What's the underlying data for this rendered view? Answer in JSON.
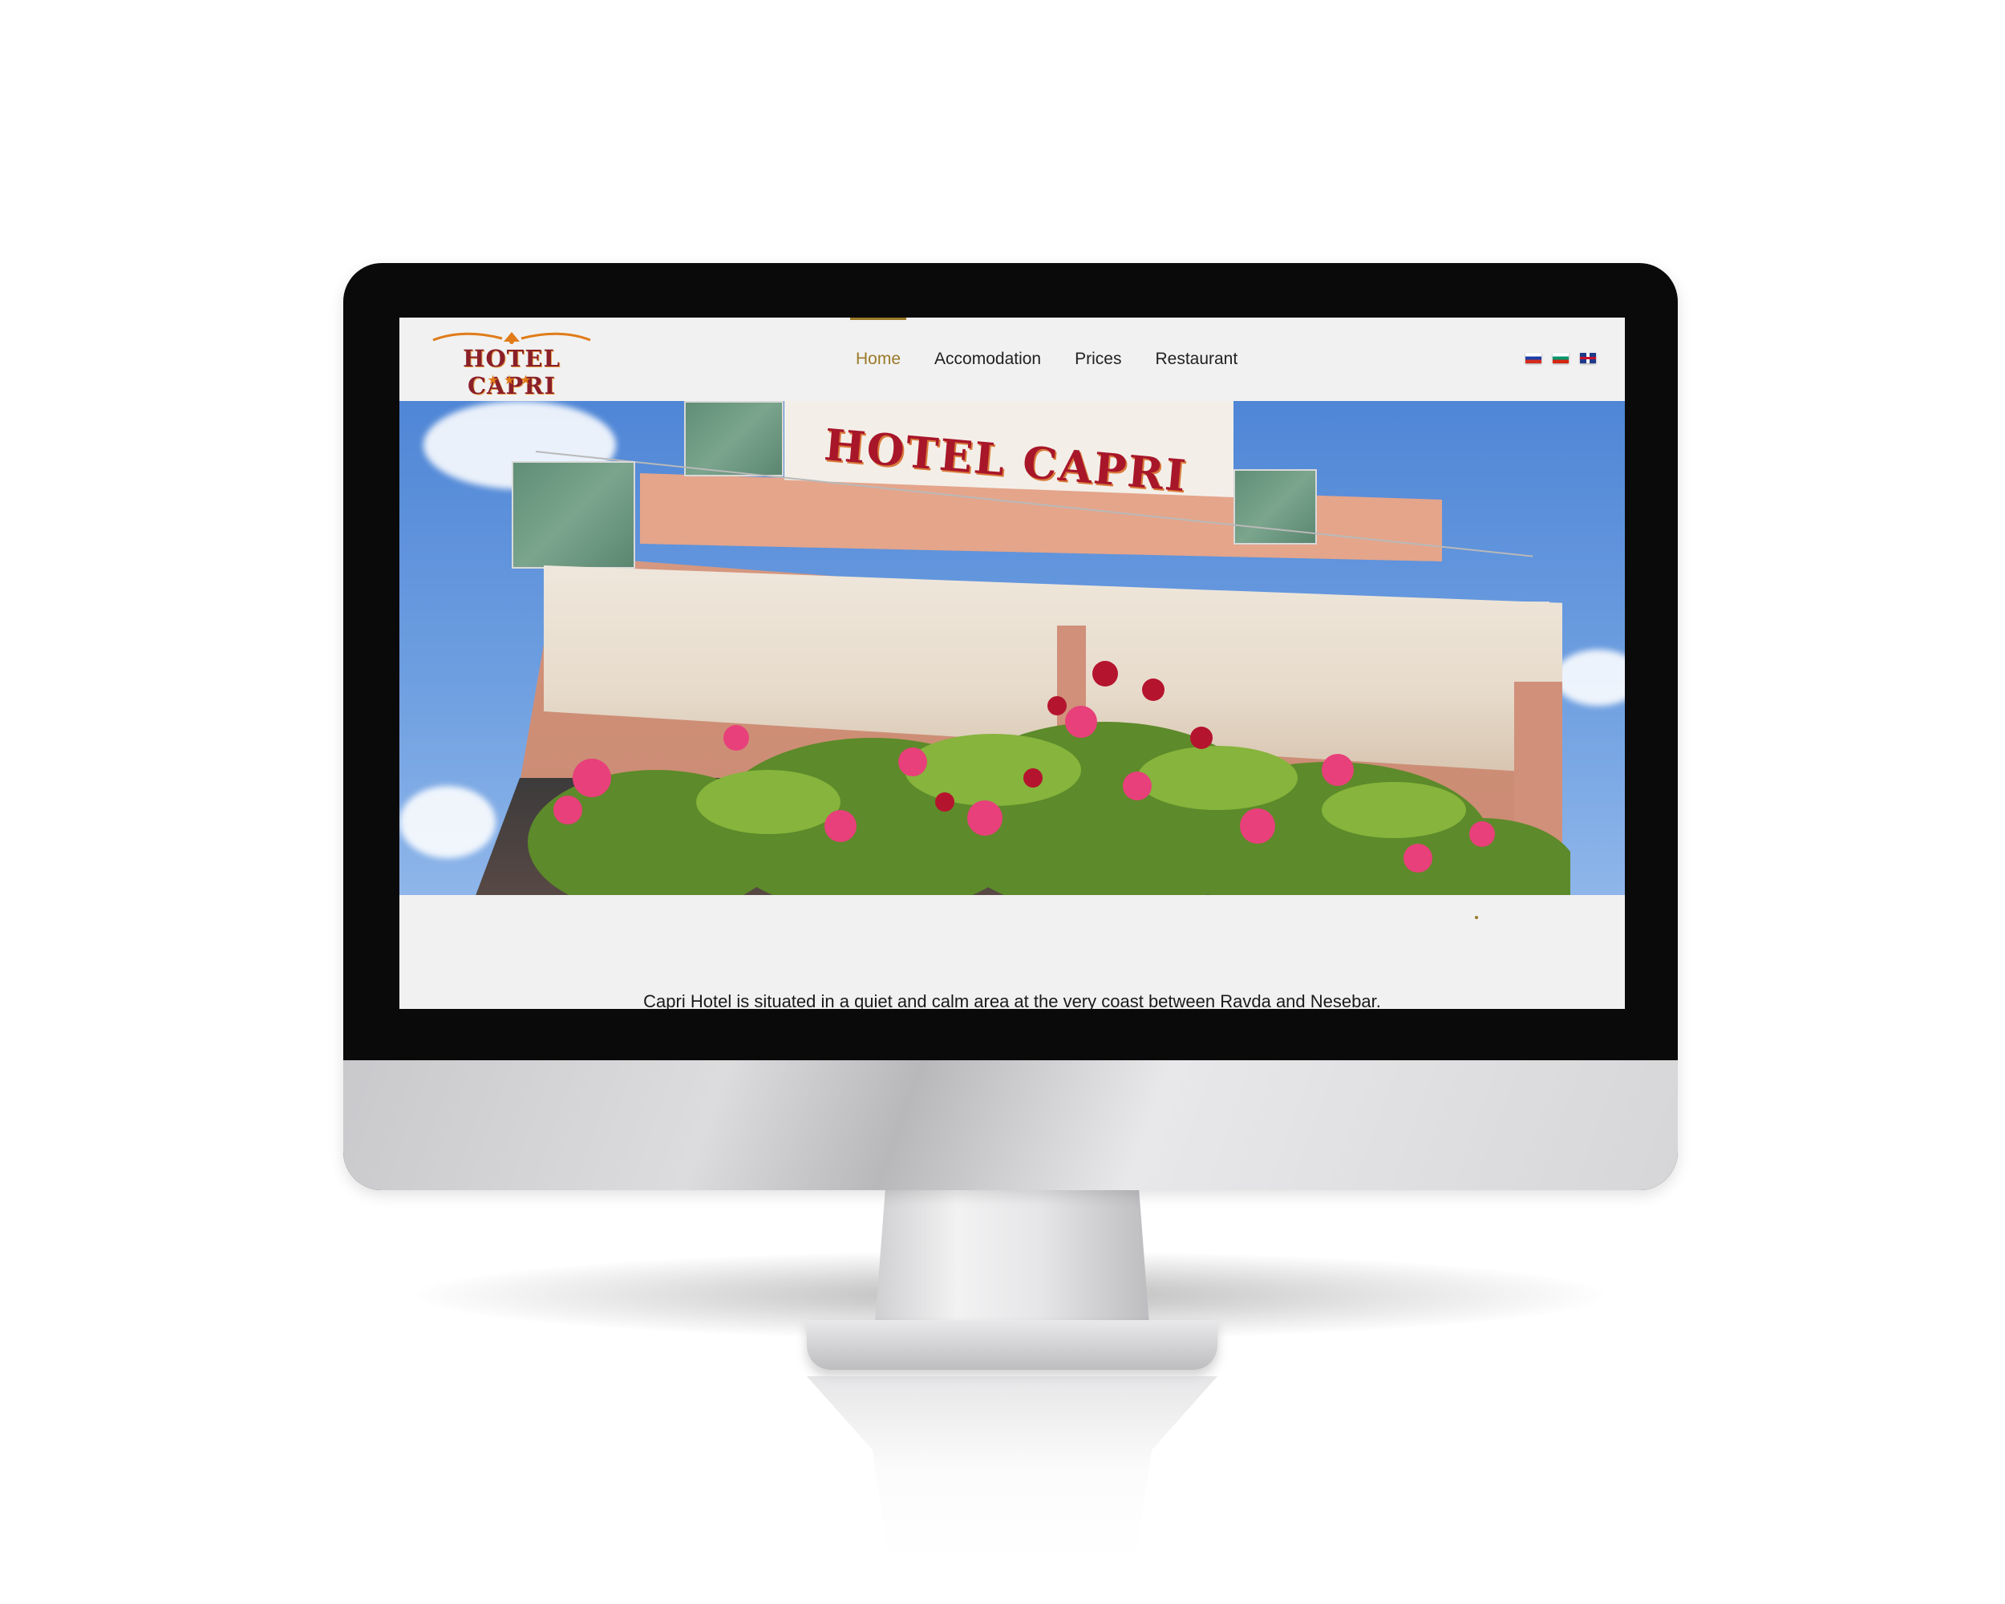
{
  "site": {
    "logo": {
      "wordmark": "HOTEL CAPRI",
      "stars": "★★★"
    },
    "nav": {
      "items": [
        {
          "label": "Home",
          "active": true
        },
        {
          "label": "Accomodation",
          "active": false
        },
        {
          "label": "Prices",
          "active": false
        },
        {
          "label": "Restaurant",
          "active": false
        }
      ],
      "active_color": "#9a7a28"
    },
    "languages": [
      {
        "icon": "flag-russia-icon"
      },
      {
        "icon": "flag-bulgaria-icon"
      },
      {
        "icon": "flag-united-kingdom-icon"
      }
    ],
    "hero": {
      "sign_text": "HOTEL CAPRI"
    },
    "intro_text": "Capri Hotel is situated in a quiet and calm area at the very coast between Ravda and Nesebar. It is a preferred destination for relax and tourism. The pleasant"
  },
  "colors": {
    "brand": "#8a1f2a",
    "accent": "#9a7a28",
    "page_background": "#f1f1f1"
  }
}
